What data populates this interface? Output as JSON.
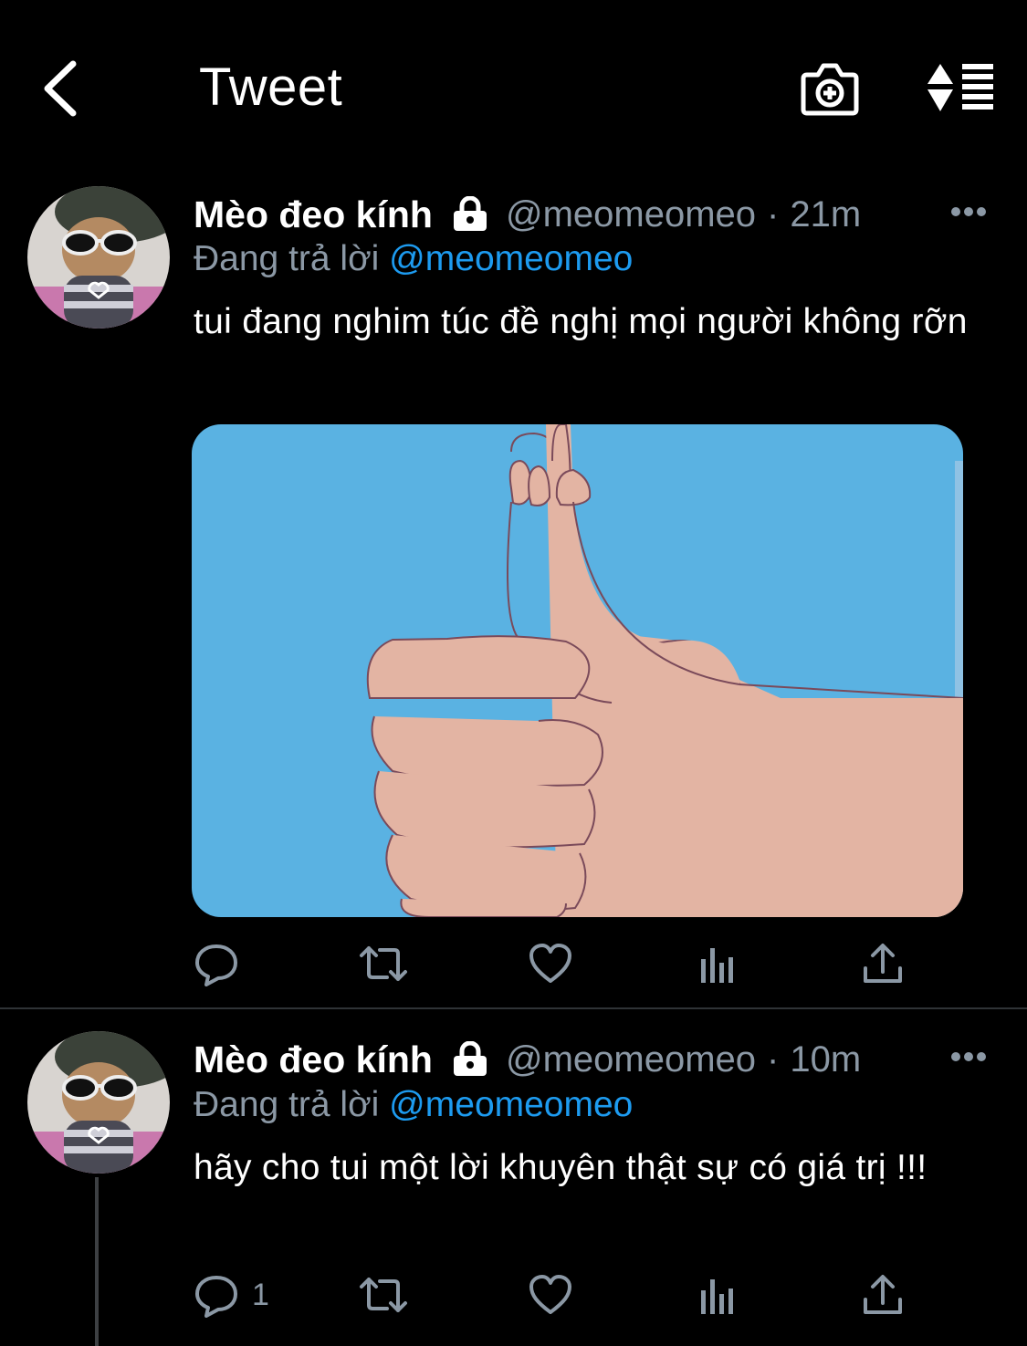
{
  "header": {
    "title": "Tweet",
    "back_icon": "chevron-left-icon",
    "camera_icon": "camera-plus-icon",
    "sort_icon": "sort-list-icon"
  },
  "tweets": [
    {
      "author_name": "Mèo đeo kính",
      "handle": "@meomeomeo",
      "separator": "·",
      "time": "21m",
      "reply_prefix": "Đang trả lời",
      "reply_to": "@meomeomeo",
      "text": "tui đang nghim túc đề nghị mọi người không rỡn",
      "has_media": true,
      "reply_count": ""
    },
    {
      "author_name": "Mèo đeo kính",
      "handle": "@meomeomeo",
      "separator": "·",
      "time": "10m",
      "reply_prefix": "Đang trả lời",
      "reply_to": "@meomeomeo",
      "text": "hãy cho tui một lời khuyên thật sự có giá trị !!!",
      "has_media": false,
      "reply_count": "1"
    }
  ],
  "colors": {
    "background": "#000000",
    "secondary_text": "#8b98a5",
    "accent": "#1d9bf0",
    "media_sky": "#5ab2e2",
    "media_hand": "#e3b4a3"
  }
}
